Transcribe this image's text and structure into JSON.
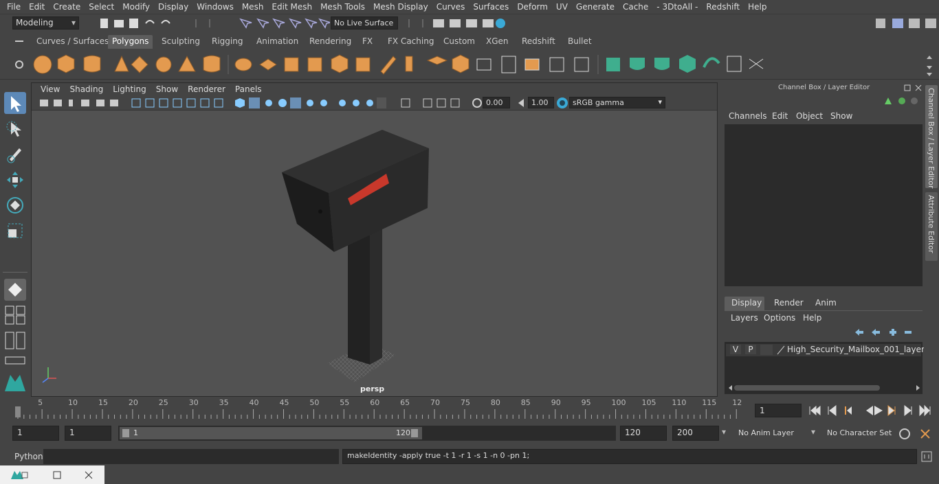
{
  "menu": [
    "File",
    "Edit",
    "Create",
    "Select",
    "Modify",
    "Display",
    "Windows",
    "Mesh",
    "Edit Mesh",
    "Mesh Tools",
    "Mesh Display",
    "Curves",
    "Surfaces",
    "Deform",
    "UV",
    "Generate",
    "Cache",
    "- 3DtoAll -",
    "Redshift",
    "Help"
  ],
  "status": {
    "mode": "Modeling",
    "live_surface": "No Live Surface"
  },
  "shelf_tabs": [
    "Curves / Surfaces",
    "Polygons",
    "Sculpting",
    "Rigging",
    "Animation",
    "Rendering",
    "FX",
    "FX Caching",
    "Custom",
    "XGen",
    "Redshift",
    "Bullet"
  ],
  "shelf_active": "Polygons",
  "viewport": {
    "menu": [
      "View",
      "Shading",
      "Lighting",
      "Show",
      "Renderer",
      "Panels"
    ],
    "exposure": "0.00",
    "gamma": "1.00",
    "colorspace": "sRGB gamma",
    "camera": "persp"
  },
  "channel_box": {
    "title": "Channel Box / Layer Editor",
    "menu": [
      "Channels",
      "Edit",
      "Object",
      "Show"
    ],
    "layer_tabs": [
      "Display",
      "Render",
      "Anim"
    ],
    "layer_active": "Display",
    "layer_menu": [
      "Layers",
      "Options",
      "Help"
    ],
    "layer": {
      "v": "V",
      "p": "P",
      "name": "High_Security_Mailbox_001_layer"
    }
  },
  "side_tabs": [
    "Channel Box / Layer Editor",
    "Attribute Editor"
  ],
  "timeline": {
    "ticks": [
      "1",
      "5",
      "10",
      "15",
      "20",
      "25",
      "30",
      "35",
      "40",
      "45",
      "50",
      "55",
      "60",
      "65",
      "70",
      "75",
      "80",
      "85",
      "90",
      "95",
      "100",
      "105",
      "110",
      "115",
      "12"
    ],
    "current_frame": "1"
  },
  "range": {
    "start": "1",
    "start2": "1",
    "slider_start": "1",
    "slider_end": "120",
    "end": "120",
    "end2": "200",
    "anim_layer": "No Anim Layer",
    "char_set": "No Character Set"
  },
  "cmdline": {
    "lang": "Python",
    "result": "makeIdentity -apply true -t 1 -r 1 -s 1 -n 0 -pn 1;"
  },
  "colors": {
    "accent_blue": "#5d89b8",
    "shelf_orange": "#e39a4f",
    "shelf_green": "#3fae8e",
    "flag_red": "#c8382b"
  }
}
